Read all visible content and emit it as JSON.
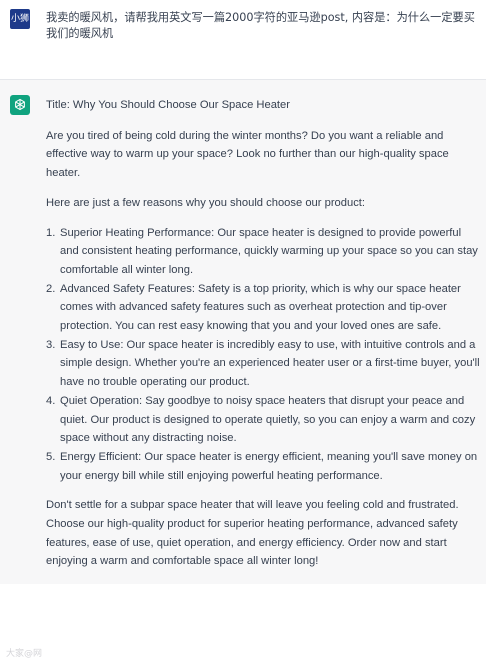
{
  "user": {
    "avatar_text": "小狮",
    "message": "我卖的暖风机，请帮我用英文写一篇2000字符的亚马逊post, 内容是：为什么一定要买我们的暖风机"
  },
  "assistant": {
    "avatar_icon": "openai-logo-icon",
    "title": "Title: Why You Should Choose Our Space Heater",
    "intro": "Are you tired of being cold during the winter months? Do you want a reliable and effective way to warm up your space? Look no further than our high-quality space heater.",
    "lead": "Here are just a few reasons why you should choose our product:",
    "reasons": [
      {
        "num": "1.",
        "text": "Superior Heating Performance: Our space heater is designed to provide powerful and consistent heating performance, quickly warming up your space so you can stay comfortable all winter long."
      },
      {
        "num": "2.",
        "text": "Advanced Safety Features: Safety is a top priority, which is why our space heater comes with advanced safety features such as overheat protection and tip-over protection. You can rest easy knowing that you and your loved ones are safe."
      },
      {
        "num": "3.",
        "text": "Easy to Use: Our space heater is incredibly easy to use, with intuitive controls and a simple design. Whether you're an experienced heater user or a first-time buyer, you'll have no trouble operating our product."
      },
      {
        "num": "4.",
        "text": "Quiet Operation: Say goodbye to noisy space heaters that disrupt your peace and quiet. Our product is designed to operate quietly, so you can enjoy a warm and cozy space without any distracting noise."
      },
      {
        "num": "5.",
        "text": "Energy Efficient: Our space heater is energy efficient, meaning you'll save money on your energy bill while still enjoying powerful heating performance."
      }
    ],
    "closing": "Don't settle for a subpar space heater that will leave you feeling cold and frustrated. Choose our high-quality product for superior heating performance, advanced safety features, ease of use, quiet operation, and energy efficiency. Order now and start enjoying a warm and comfortable space all winter long!"
  },
  "watermark": "大家@网",
  "colors": {
    "user_avatar_bg": "#1e3a8a",
    "assistant_avatar_bg": "#10a37f",
    "assistant_bg": "#f7f7f8",
    "text": "#374151"
  }
}
